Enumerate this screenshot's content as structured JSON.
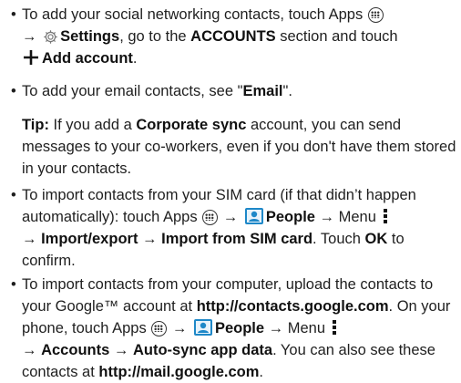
{
  "bullet_char": "•",
  "p1": {
    "t1": "To add your social networking contacts, touch Apps ",
    "t2": " → ",
    "settings": "Settings",
    "t3": ", go to the ",
    "accounts_section": "ACCOUNTS",
    "t4": " section and touch",
    "add_account": "Add account",
    "t5": "."
  },
  "p2": {
    "t1": "To add your email contacts, see \"",
    "email": "Email",
    "t2": "\"."
  },
  "tip": {
    "label": "Tip:",
    "t1": " If you add a ",
    "corporate_sync": "Corporate sync",
    "t2": " account, you can send messages to your co-workers, even if you don't have them stored in your contacts."
  },
  "p3": {
    "t1": "To import contacts from your SIM card (if that didn’t happen automatically): touch Apps ",
    "t2": " → ",
    "people": "People",
    "t3": " → Menu ",
    "t4": "→ ",
    "import_export": "Import/export",
    "t5": " → ",
    "import_sim": "Import from SIM card",
    "t6": ". Touch ",
    "ok": "OK",
    "t7": " to confirm."
  },
  "p4": {
    "t1": "To import contacts from your computer, upload the contacts to your Google™ account at ",
    "link1": "http://contacts.google.com",
    "t2": ". On your phone, touch Apps ",
    "t3": " → ",
    "people": "People",
    "t4": " → Menu ",
    "t5": "→ ",
    "accounts": "Accounts",
    "t6": " → ",
    "autosync": "Auto-sync app data",
    "t7": ". You can also see these contacts at ",
    "link2": "http://mail.google.com",
    "t8": "."
  },
  "icons": {
    "apps": "apps-icon",
    "settings": "gear-icon",
    "add": "plus-icon",
    "people": "people-icon",
    "menu": "menu-dots-icon"
  },
  "colors": {
    "text": "#1f1f1f",
    "people_icon": "#1e88c8"
  }
}
